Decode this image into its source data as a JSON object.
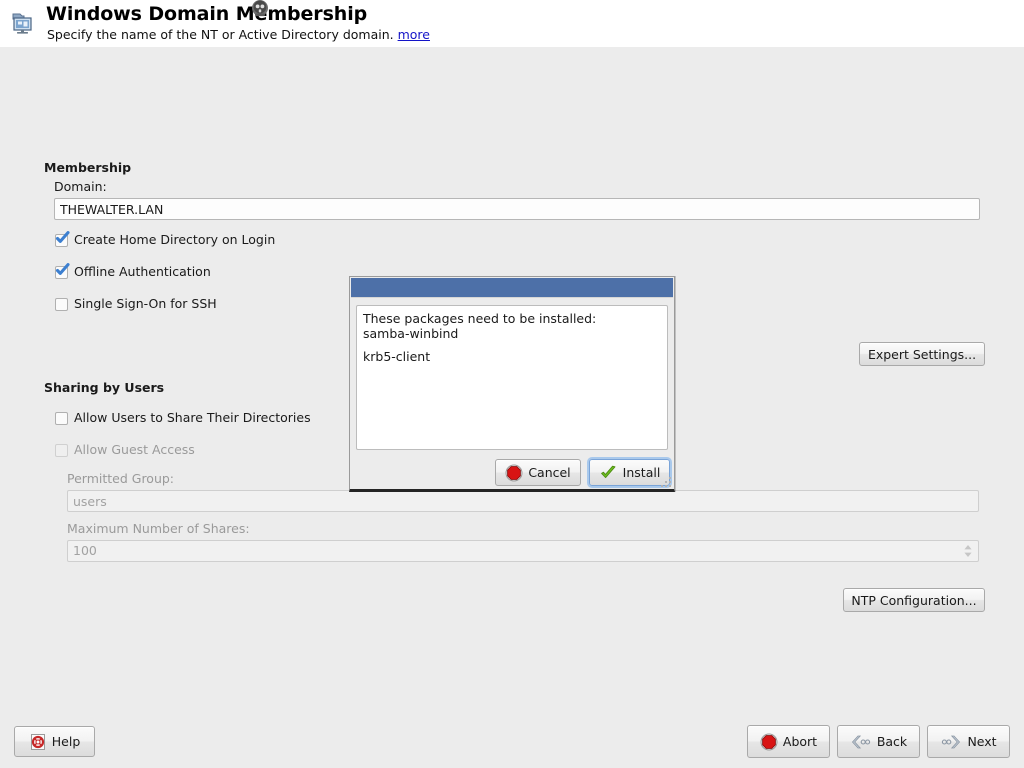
{
  "header": {
    "icon": "network-computer-icon",
    "title": "Windows Domain Membership",
    "subtitle": "Specify the name of the NT or Active Directory domain.",
    "more_link": "more",
    "busy_cursor_icon": "busy-cursor-icon"
  },
  "colors": {
    "page_background": "#ececec",
    "header_background": "#ffffff",
    "dialog_titlebar": "#4d70a8",
    "link": "#1414c8",
    "checkbox_check": "#3c7fd0",
    "abort_red": "#d81414",
    "install_green": "#6fbf1f",
    "focus_ring": "#a9c9ec"
  },
  "membership": {
    "group_title": "Membership",
    "domain_label": "Domain:",
    "domain_value": "THEWALTER.LAN",
    "domain_placeholder": "",
    "checkboxes": [
      {
        "label": "Create Home Directory on Login",
        "checked": true,
        "disabled": false
      },
      {
        "label": "Offline Authentication",
        "checked": true,
        "disabled": false
      },
      {
        "label": "Single Sign-On for SSH",
        "checked": false,
        "disabled": false
      }
    ],
    "expert_settings_button": "Expert Settings..."
  },
  "sharing": {
    "group_title": "Sharing by Users",
    "checkboxes": [
      {
        "label": "Allow Users to Share Their Directories",
        "checked": false,
        "disabled": false
      },
      {
        "label": "Allow Guest Access",
        "checked": false,
        "disabled": true
      }
    ],
    "permitted_group_label": "Permitted Group:",
    "permitted_group_value": "users",
    "max_shares_label": "Maximum Number of Shares:",
    "max_shares_value": "100",
    "ntp_configuration_button": "NTP Configuration..."
  },
  "dialog": {
    "title": "",
    "message": "These packages need to be installed:",
    "packages": [
      "samba-winbind",
      "krb5-client"
    ],
    "cancel_button": "Cancel",
    "install_button": "Install",
    "cancel_icon": "stop-icon",
    "install_icon": "check-icon",
    "resize_grip_icon": "resize-grip-icon"
  },
  "footer": {
    "help_button": "Help",
    "help_icon": "help-lifering-icon",
    "abort_button": "Abort",
    "abort_icon": "stop-icon",
    "back_button": "Back",
    "back_icon": "chevron-left-icon",
    "next_button": "Next",
    "next_icon": "chevron-right-icon"
  }
}
